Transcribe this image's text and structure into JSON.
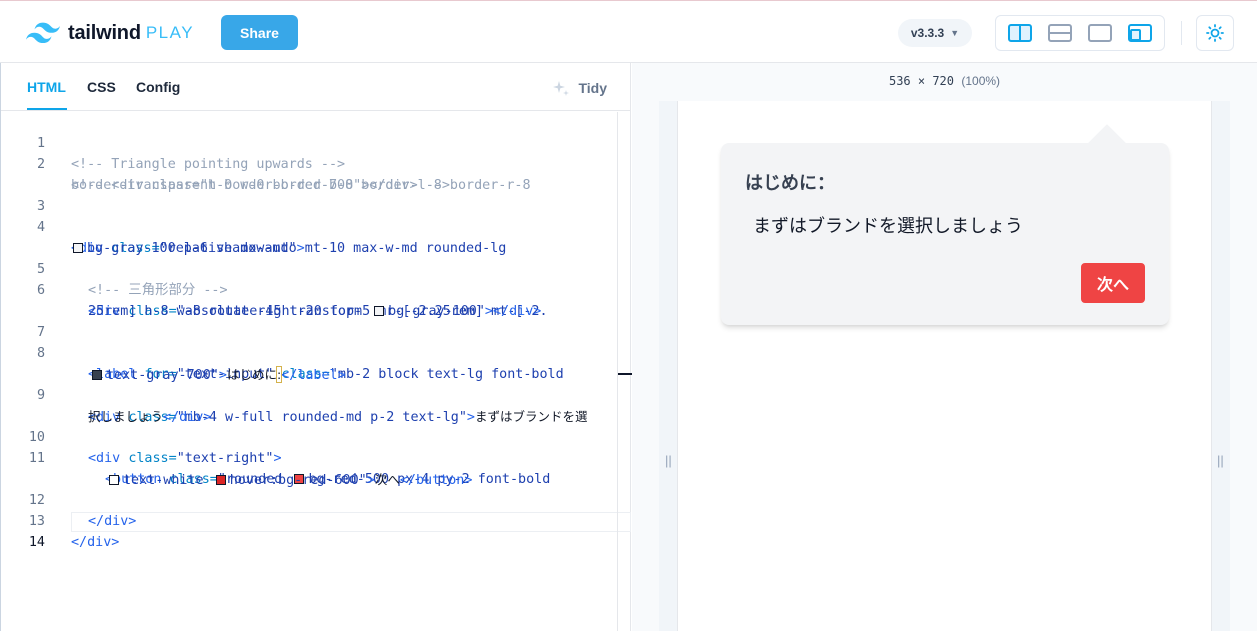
{
  "header": {
    "logo_word": "tailwind",
    "logo_play": "PLAY",
    "share_label": "Share",
    "version_label": "v3.3.3",
    "layout_buttons": [
      "split-vertical-icon",
      "split-horizontal-icon",
      "preview-only-icon",
      "responsive-icon"
    ],
    "accent_color": "#38bdf8"
  },
  "editor": {
    "tabs": [
      {
        "label": "HTML",
        "active": true
      },
      {
        "label": "CSS",
        "active": false
      },
      {
        "label": "Config",
        "active": false
      }
    ],
    "tidy_label": "Tidy",
    "line_numbers": [
      "1",
      "2",
      "3",
      "4",
      "5",
      "6",
      "7",
      "8",
      "9",
      "10",
      "11",
      "12",
      "13",
      "14"
    ],
    "current_line": "14"
  },
  "preview": {
    "size_label": "536 × 720",
    "zoom_label": "(100%)",
    "card": {
      "title": "はじめに：",
      "body": "まずはブランドを選択しましょう",
      "button_label": "次へ",
      "button_color": "#ef4444"
    }
  }
}
